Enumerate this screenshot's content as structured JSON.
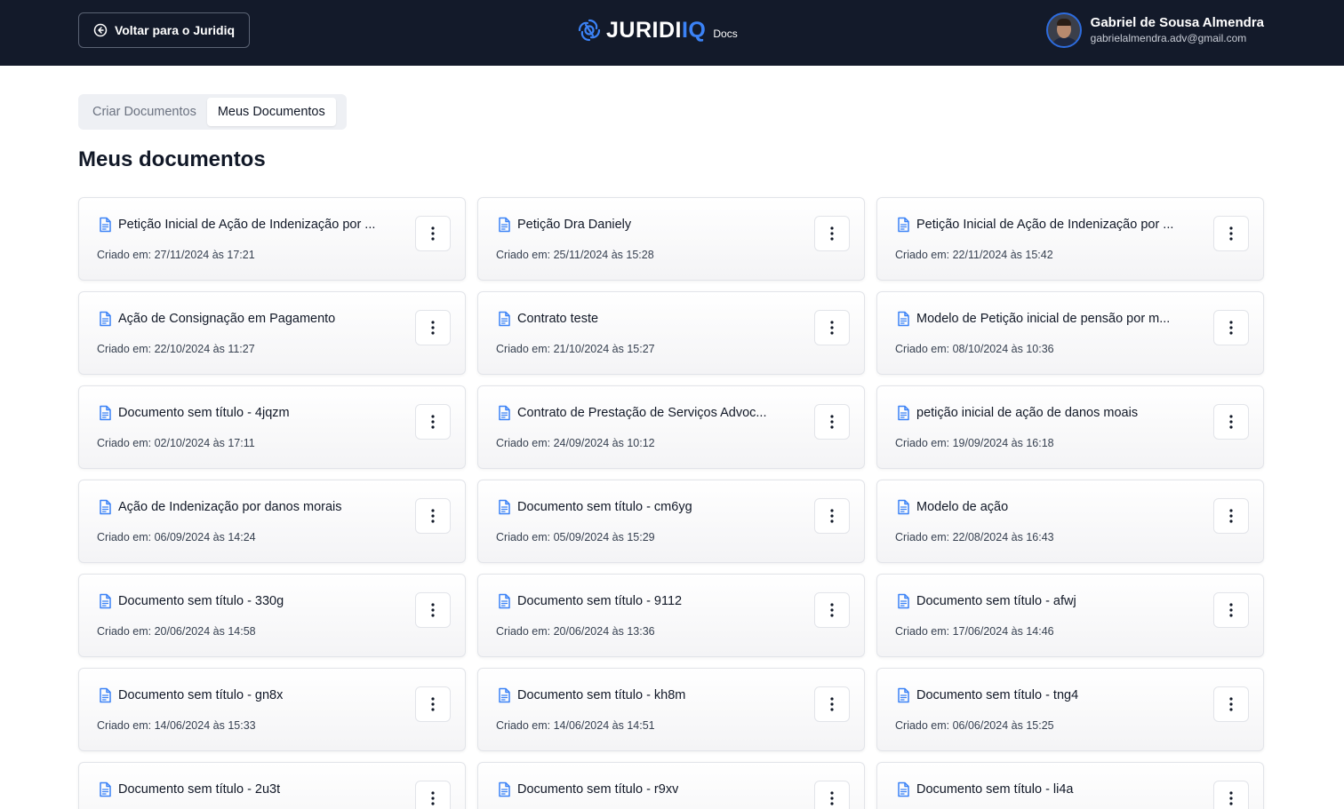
{
  "header": {
    "back_label": "Voltar para o Juridiq",
    "logo_main": "JURIDI",
    "logo_accent": "IQ",
    "logo_sub": "Docs",
    "user_name": "Gabriel de Sousa Almendra",
    "user_email": "gabrielalmendra.adv@gmail.com"
  },
  "tabs": [
    {
      "label": "Criar Documentos",
      "active": false
    },
    {
      "label": "Meus Documentos",
      "active": true
    }
  ],
  "page_title": "Meus documentos",
  "colors": {
    "header_bg": "#131a2a",
    "accent": "#3b82f6"
  },
  "documents": [
    {
      "title": "Petição Inicial de Ação de Indenização por ...",
      "date": "Criado em: 27/11/2024 às 17:21"
    },
    {
      "title": "Petição Dra Daniely",
      "date": "Criado em: 25/11/2024 às 15:28"
    },
    {
      "title": "Petição Inicial de Ação de Indenização por ...",
      "date": "Criado em: 22/11/2024 às 15:42"
    },
    {
      "title": "Ação de Consignação em Pagamento",
      "date": "Criado em: 22/10/2024 às 11:27"
    },
    {
      "title": "Contrato teste",
      "date": "Criado em: 21/10/2024 às 15:27"
    },
    {
      "title": "Modelo de Petição inicial de pensão por m...",
      "date": "Criado em: 08/10/2024 às 10:36"
    },
    {
      "title": "Documento sem título - 4jqzm",
      "date": "Criado em: 02/10/2024 às 17:11"
    },
    {
      "title": "Contrato de Prestação de Serviços Advoc...",
      "date": "Criado em: 24/09/2024 às 10:12"
    },
    {
      "title": "petição inicial de ação de danos moais",
      "date": "Criado em: 19/09/2024 às 16:18"
    },
    {
      "title": "Ação de Indenização por danos morais",
      "date": "Criado em: 06/09/2024 às 14:24"
    },
    {
      "title": "Documento sem título - cm6yg",
      "date": "Criado em: 05/09/2024 às 15:29"
    },
    {
      "title": "Modelo de ação",
      "date": "Criado em: 22/08/2024 às 16:43"
    },
    {
      "title": "Documento sem título - 330g",
      "date": "Criado em: 20/06/2024 às 14:58"
    },
    {
      "title": "Documento sem título - 9112",
      "date": "Criado em: 20/06/2024 às 13:36"
    },
    {
      "title": "Documento sem título - afwj",
      "date": "Criado em: 17/06/2024 às 14:46"
    },
    {
      "title": "Documento sem título - gn8x",
      "date": "Criado em: 14/06/2024 às 15:33"
    },
    {
      "title": "Documento sem título - kh8m",
      "date": "Criado em: 14/06/2024 às 14:51"
    },
    {
      "title": "Documento sem título - tng4",
      "date": "Criado em: 06/06/2024 às 15:25"
    },
    {
      "title": "Documento sem título - 2u3t",
      "date": ""
    },
    {
      "title": "Documento sem título - r9xv",
      "date": ""
    },
    {
      "title": "Documento sem título - li4a",
      "date": ""
    }
  ]
}
